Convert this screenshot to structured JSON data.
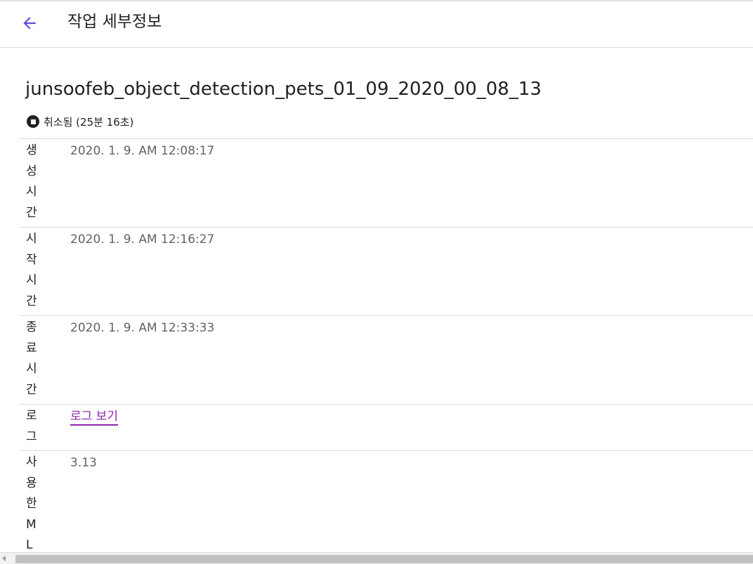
{
  "app_bar": {
    "back_icon": "arrow-back-icon",
    "title": "작업 세부정보",
    "accent_color": "#5c4ed6"
  },
  "job": {
    "name": "junsoofeb_object_detection_pets_01_09_2020_00_08_13",
    "status_icon": "stop-circle-icon",
    "status": "취소됨 (25분 16초)"
  },
  "details": {
    "rows": [
      {
        "label": "생성시간",
        "value": "2020. 1. 9. AM 12:08:17"
      },
      {
        "label": "시작시간",
        "value": "2020. 1. 9. AM 12:16:27"
      },
      {
        "label": "종료시간",
        "value": "2020. 1. 9. AM 12:33:33"
      },
      {
        "label": "로그",
        "value": "로그 보기",
        "link_color": "#8e24aa"
      },
      {
        "label": "사용한ML단",
        "value": "3.13"
      }
    ]
  }
}
